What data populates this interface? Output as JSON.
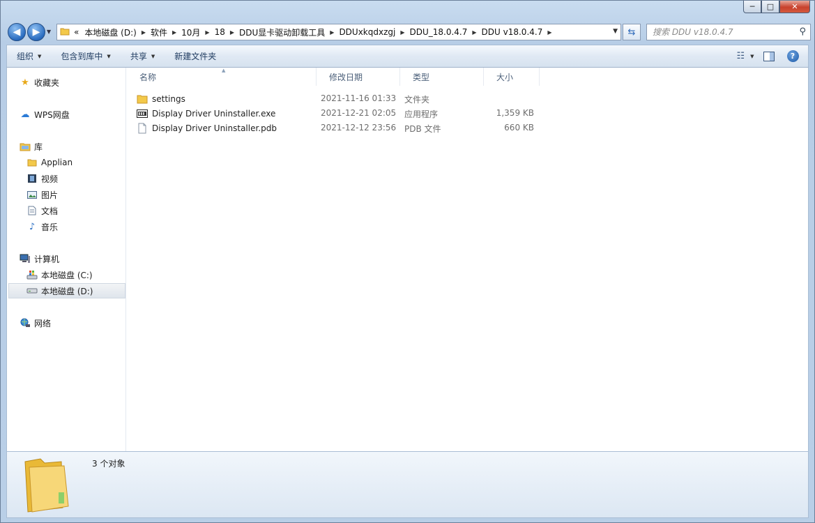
{
  "window": {
    "controls": {
      "minimize": "─",
      "maximize": "□",
      "close": "✕"
    }
  },
  "address": {
    "overflow": "«",
    "crumbs": [
      "本地磁盘 (D:)",
      "软件",
      "10月",
      "18",
      "DDU显卡驱动卸载工具",
      "DDUxkqdxzgj",
      "DDU_18.0.4.7",
      "DDU v18.0.4.7"
    ],
    "search_placeholder": "搜索 DDU v18.0.4.7"
  },
  "toolbar": {
    "organize": "组织",
    "include_library": "包含到库中",
    "share": "共享",
    "new_folder": "新建文件夹"
  },
  "nav": {
    "favorites": "收藏夹",
    "wps": "WPS网盘",
    "library": "库",
    "library_items": [
      "Applian",
      "视频",
      "图片",
      "文档",
      "音乐"
    ],
    "computer": "计算机",
    "drives": [
      "本地磁盘 (C:)",
      "本地磁盘 (D:)"
    ],
    "network": "网络"
  },
  "columns": {
    "name": "名称",
    "modified": "修改日期",
    "type": "类型",
    "size": "大小"
  },
  "files": [
    {
      "name": "settings",
      "modified": "2021-11-16 01:33",
      "type": "文件夹",
      "size": "",
      "icon": "folder-icon"
    },
    {
      "name": "Display Driver Uninstaller.exe",
      "modified": "2021-12-21 02:05",
      "type": "应用程序",
      "size": "1,359 KB",
      "icon": "exe-icon"
    },
    {
      "name": "Display Driver Uninstaller.pdb",
      "modified": "2021-12-12 23:56",
      "type": "PDB 文件",
      "size": "660 KB",
      "icon": "file-icon"
    }
  ],
  "status": {
    "count": "3 个对象"
  },
  "colors": {
    "selection": "#dfe5ec",
    "folder": "#f3c94a",
    "link": "#1e3a5f"
  }
}
